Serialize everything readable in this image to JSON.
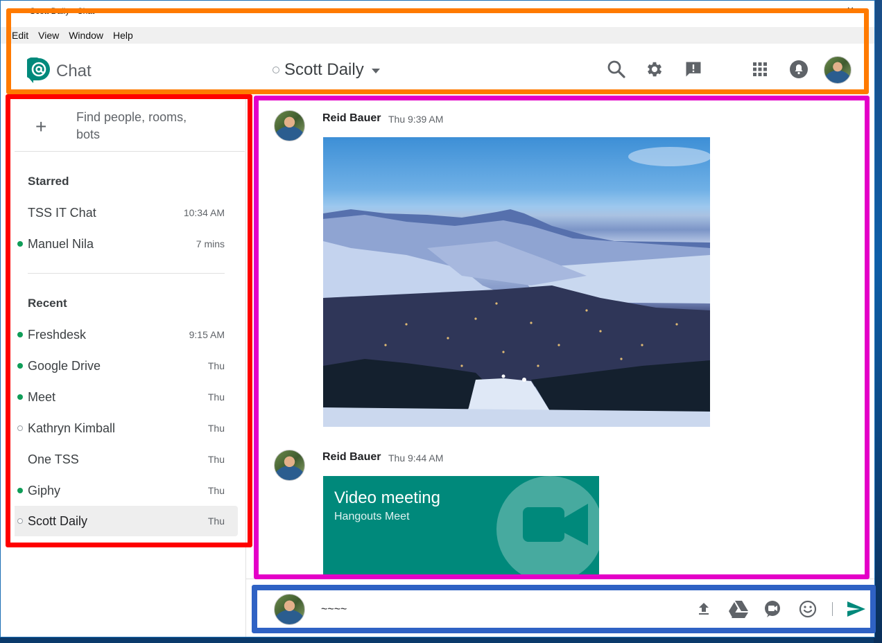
{
  "window": {
    "title": "Scott Daily - Chat"
  },
  "menu": [
    "Edit",
    "View",
    "Window",
    "Help"
  ],
  "header": {
    "brand": "Chat",
    "room_title": "Scott Daily",
    "icons": [
      "search-icon",
      "settings-icon",
      "feedback-icon",
      "apps-grid-icon",
      "notifications-icon",
      "account-avatar"
    ]
  },
  "sidebar": {
    "find_placeholder_line1": "Find people, rooms,",
    "find_placeholder_line2": "bots",
    "starred_heading": "Starred",
    "starred": [
      {
        "name": "TSS IT Chat",
        "time": "10:34 AM",
        "status": "none"
      },
      {
        "name": "Manuel Nila",
        "time": "7 mins",
        "status": "online"
      }
    ],
    "recent_heading": "Recent",
    "recent": [
      {
        "name": "Freshdesk",
        "time": "9:15 AM",
        "status": "online"
      },
      {
        "name": "Google Drive",
        "time": "Thu",
        "status": "online"
      },
      {
        "name": "Meet",
        "time": "Thu",
        "status": "online"
      },
      {
        "name": "Kathryn Kimball",
        "time": "Thu",
        "status": "offline"
      },
      {
        "name": "One TSS",
        "time": "Thu",
        "status": "none"
      },
      {
        "name": "Giphy",
        "time": "Thu",
        "status": "online"
      },
      {
        "name": "Scott Daily",
        "time": "Thu",
        "status": "offline",
        "selected": true
      }
    ]
  },
  "messages": [
    {
      "author": "Reid Bauer",
      "time": "Thu 9:39 AM",
      "attachment": "photo"
    },
    {
      "author": "Reid Bauer",
      "time": "Thu 9:44 AM",
      "attachment": "video-meeting",
      "card_title": "Video meeting",
      "card_subtitle": "Hangouts Meet"
    }
  ],
  "compose": {
    "value": "~~~~",
    "icons": [
      "upload-icon",
      "google-drive-icon",
      "video-meeting-icon",
      "emoji-icon",
      "send-icon"
    ]
  },
  "colors": {
    "accent": "#00897b",
    "online": "#0f9d58",
    "overlay_orange": "#ff7a00",
    "overlay_red": "#ff0000",
    "overlay_magenta": "#e400c8",
    "overlay_blue": "#2f62c4"
  }
}
